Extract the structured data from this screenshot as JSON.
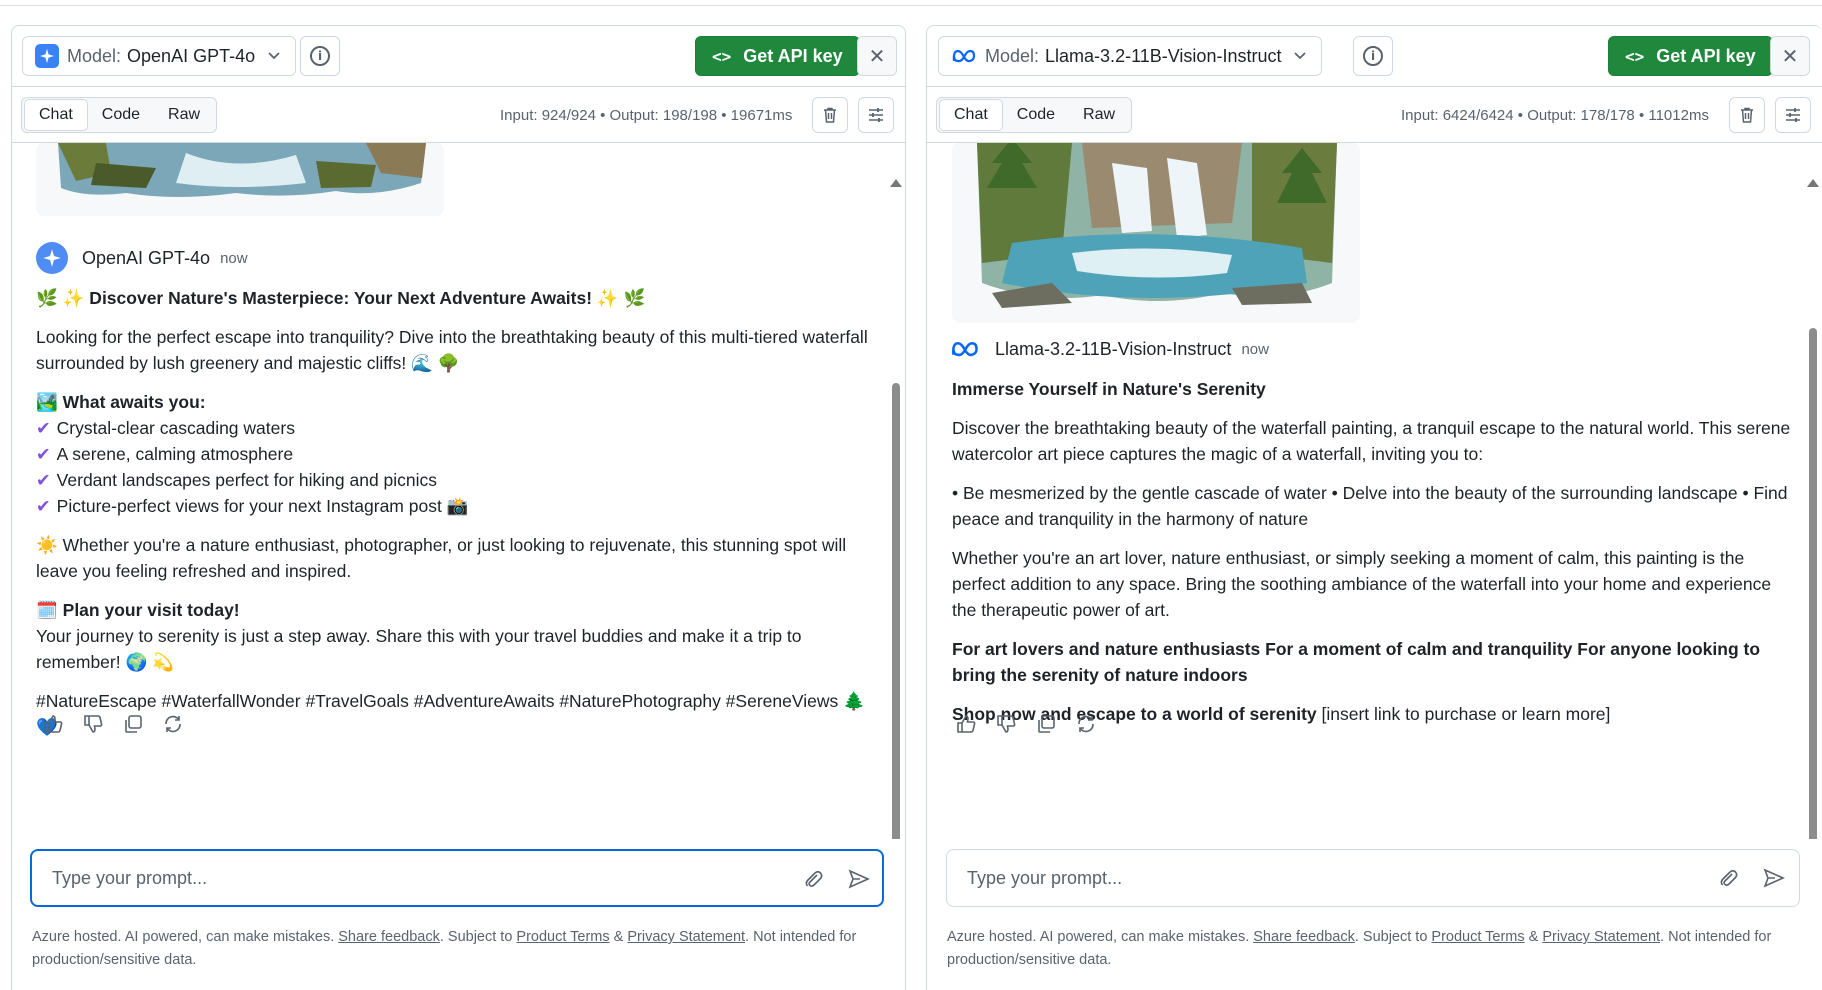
{
  "left": {
    "model_label": "Model:",
    "model_name": "OpenAI GPT-4o",
    "api_button": "Get API key",
    "tabs": [
      "Chat",
      "Code",
      "Raw"
    ],
    "stats": "Input: 924/924 • Output: 198/198 • 19671ms",
    "message": {
      "author": "OpenAI GPT-4o",
      "time": "now",
      "headline": "🌿 ✨ Discover Nature's Masterpiece: Your Next Adventure Awaits! ✨ 🌿",
      "intro": "Looking for the perfect escape into tranquility? Dive into the breathtaking beauty of this multi-tiered waterfall surrounded by lush greenery and majestic cliffs! 🌊 🌳",
      "awaits_title": "🏞️ What awaits you:",
      "awaits_items": [
        "Crystal-clear cascading waters",
        "A serene, calming atmosphere",
        "Verdant landscapes perfect for hiking and picnics",
        "Picture-perfect views for your next Instagram post 📸"
      ],
      "enthusiast": "☀️ Whether you're a nature enthusiast, photographer, or just looking to rejuvenate, this stunning spot will leave you feeling refreshed and inspired.",
      "plan_title": "🗓️ Plan your visit today!",
      "plan_text": "Your journey to serenity is just a step away. Share this with your travel buddies and make it a trip to remember! 🌍 💫",
      "hashtags": "#NatureEscape #WaterfallWonder #TravelGoals #AdventureAwaits #NaturePhotography #SereneViews 🌲 💙"
    },
    "prompt_placeholder": "Type your prompt..."
  },
  "right": {
    "model_label": "Model:",
    "model_name": "Llama-3.2-11B-Vision-Instruct",
    "api_button": "Get API key",
    "tabs": [
      "Chat",
      "Code",
      "Raw"
    ],
    "stats": "Input: 6424/6424 • Output: 178/178 • 11012ms",
    "message": {
      "author": "Llama-3.2-11B-Vision-Instruct",
      "time": "now",
      "headline": "Immerse Yourself in Nature's Serenity",
      "para1": "Discover the breathtaking beauty of the waterfall painting, a tranquil escape to the natural world. This serene watercolor art piece captures the magic of a waterfall, inviting you to:",
      "para2": "• Be mesmerized by the gentle cascade of water • Delve into the beauty of the surrounding landscape • Find peace and tranquility in the harmony of nature",
      "para3": "Whether you're an art lover, nature enthusiast, or simply seeking a moment of calm, this painting is the perfect addition to any space. Bring the soothing ambiance of the waterfall into your home and experience the therapeutic power of art.",
      "para4": "For art lovers and nature enthusiasts For a moment of calm and tranquility For anyone looking to bring the serenity of nature indoors",
      "shop_bold": "Shop now and escape to a world of serenity",
      "shop_rest": " [insert link to purchase or learn more]"
    },
    "prompt_placeholder": "Type your prompt..."
  },
  "footer": {
    "text1": "Azure hosted. AI powered, can make mistakes. ",
    "share_feedback": "Share feedback",
    "text2": ". Subject to ",
    "product_terms": "Product Terms",
    "text3": " & ",
    "privacy": "Privacy Statement",
    "text4": ". Not intended for production/sensitive data."
  },
  "colors": {
    "accent_green": "#1f883d",
    "focus_blue": "#0969da",
    "check_purple": "#8250df",
    "border": "#d1d9e0"
  },
  "icons": [
    "chevron-down-icon",
    "info-icon",
    "code-icon",
    "close-icon",
    "trash-icon",
    "settings-sliders-icon",
    "thumbs-up-icon",
    "thumbs-down-icon",
    "copy-icon",
    "refresh-icon",
    "paperclip-icon",
    "send-icon",
    "sparkle-icon",
    "meta-icon"
  ]
}
